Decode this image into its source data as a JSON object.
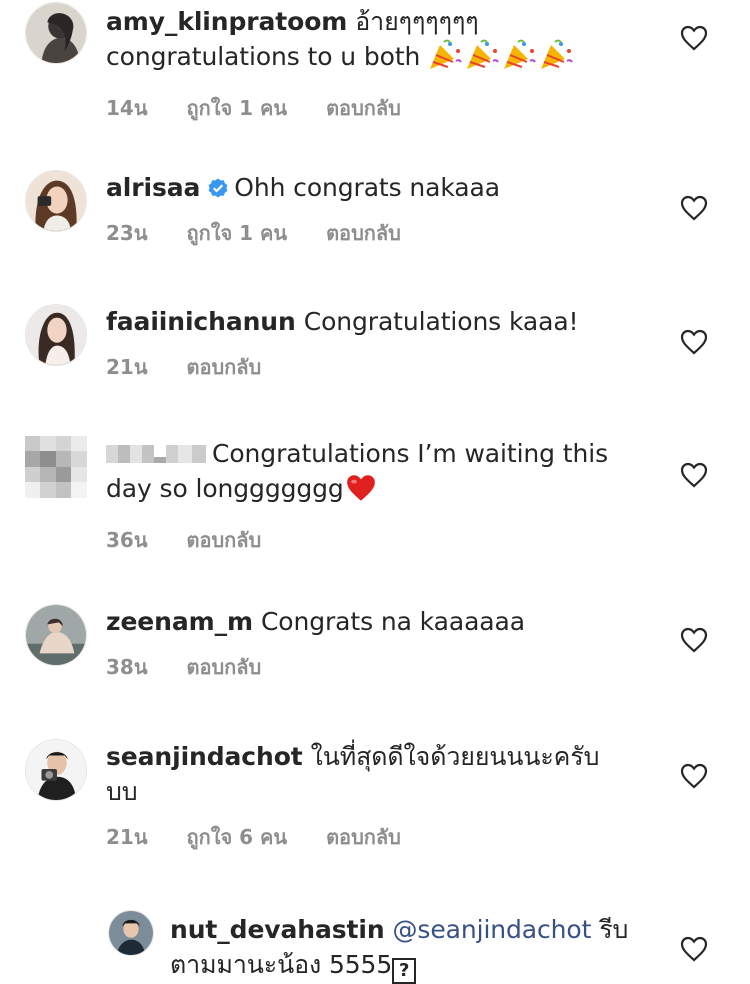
{
  "comments": [
    {
      "username": "amy_klinpratoom",
      "text": "อ้ายๆๆๆๆๆๆ",
      "text2": "congratulations to u both",
      "emojis": "🎉🎉🎉🎉",
      "time": "14น",
      "likes": "ถูกใจ 1 คน",
      "reply": "ตอบกลับ"
    },
    {
      "username": "alrisaa",
      "verified": true,
      "text": "Ohh congrats nakaaa",
      "time": "23น",
      "likes": "ถูกใจ 1 คน",
      "reply": "ตอบกลับ"
    },
    {
      "username": "faaiinichanun",
      "text": "Congratulations kaaa!",
      "time": "21น",
      "reply": "ตอบกลับ"
    },
    {
      "username": "",
      "text": "Congratulations I’m waiting this",
      "text2": "day so longgggggg",
      "emojis": "❤️",
      "time": "36น",
      "reply": "ตอบกลับ"
    },
    {
      "username": "zeenam_m",
      "text": "Congrats na kaaaaaa",
      "time": "38น",
      "reply": "ตอบกลับ"
    },
    {
      "username": "seanjindachot",
      "text": "ในที่สุดดีใจด้วยยนนนะครับ",
      "text2": "บบ",
      "time": "21น",
      "likes": "ถูกใจ 6 คน",
      "reply": "ตอบกลับ"
    },
    {
      "username": "nut_devahastin",
      "mention": "@seanjindachot",
      "text": "รีบ",
      "text2": "ตามมานะน้อง 5555",
      "qbox": "?"
    }
  ],
  "colors": {
    "username": "#262626",
    "meta": "#8e8e8e",
    "mention": "#385185",
    "verified": "#3897f0",
    "heart_stroke": "#262626",
    "red_heart": "#e0201f"
  },
  "icons": {
    "like": "heart-outline-icon",
    "verified": "verified-badge-icon",
    "party": "party-popper-emoji",
    "red_heart": "red-heart-emoji"
  }
}
